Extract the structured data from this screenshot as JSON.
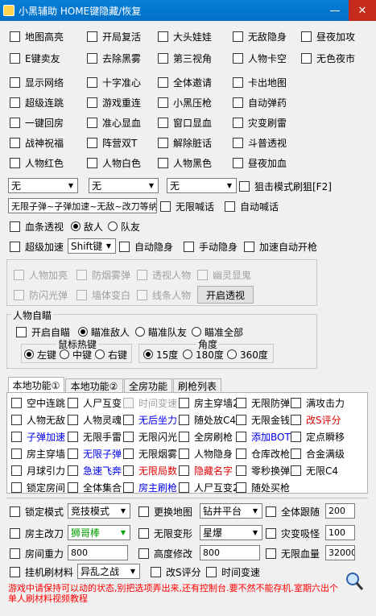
{
  "window": {
    "title": "小黑辅助  HOME键隐藏/恢复",
    "minimize": "—",
    "close": "✕"
  },
  "top_checks": [
    [
      "地图高亮",
      "开局复活",
      "大头娃娃",
      "无敌隐身",
      "昼夜加攻"
    ],
    [
      "E键卖友",
      "去除黑雾",
      "第三视角",
      "人物卡空",
      "无色夜市"
    ],
    [
      "显示网络",
      "十字准心",
      "全体邀请",
      "卡出地图"
    ],
    [
      "超级连跳",
      "游戏重连",
      "小黑压枪",
      "自动弹药"
    ],
    [
      "一键回房",
      "准心显血",
      "窗口显血",
      "灾变刷雷"
    ],
    [
      "战神祝福",
      "阵营双T",
      "解除脏话",
      "斗普透视"
    ],
    [
      "人物红色",
      "人物白色",
      "人物黑色",
      "昼夜加血"
    ]
  ],
  "combo1": {
    "a": "无",
    "b": "无",
    "c": "无"
  },
  "sniper_label": "狙击模式刷狙[F2]",
  "spam_text": "无限子弹~子弹加速~无敌~改刀等纳",
  "unlimited_shout": "无限喊话",
  "auto_shout": "自动喊话",
  "blood_perspective": "血条透视",
  "enemy": "敌人",
  "teammate": "队友",
  "super_speed": "超级加速",
  "shift_key": "Shift键",
  "auto_stealth": "自动隐身",
  "manual_stealth": "手动隐身",
  "speed_auto_fire": "加速自动开枪",
  "disabled_group": {
    "items": [
      "人物加亮",
      "防烟雾弹",
      "透视人物",
      "幽灵显鬼",
      "防闪光弹",
      "墙体变白",
      "线条人物"
    ],
    "button": "开启透视"
  },
  "aimbot": {
    "group_label": "人物自瞄",
    "enable": "开启自瞄",
    "aim_enemy": "瞄准敌人",
    "aim_team": "瞄准队友",
    "aim_all": "瞄准全部",
    "hotkey_label": "鼠标热键",
    "left": "左键",
    "middle": "中键",
    "right": "右键",
    "angle_label": "角度",
    "a15": "15度",
    "a180": "180度",
    "a360": "360度"
  },
  "tabs": [
    "本地功能①",
    "本地功能②",
    "全房功能",
    "刷枪列表"
  ],
  "tab_items": [
    {
      "t": "空中连跳",
      "c": ""
    },
    {
      "t": "人尸互变",
      "c": ""
    },
    {
      "t": "时间变速",
      "c": "dis"
    },
    {
      "t": "房主穿墙2",
      "c": ""
    },
    {
      "t": "无限防弹",
      "c": ""
    },
    {
      "t": "满攻击力",
      "c": ""
    },
    {
      "t": "人物无敌",
      "c": ""
    },
    {
      "t": "人物灵魂",
      "c": ""
    },
    {
      "t": "无后坐力",
      "c": "blue"
    },
    {
      "t": "随处放C4",
      "c": ""
    },
    {
      "t": "无限金钱",
      "c": ""
    },
    {
      "t": "改S评分",
      "c": "red"
    },
    {
      "t": "子弹加速",
      "c": "blue"
    },
    {
      "t": "无限手雷",
      "c": ""
    },
    {
      "t": "无限闪光",
      "c": ""
    },
    {
      "t": "全房刷枪",
      "c": ""
    },
    {
      "t": "添加BOT",
      "c": "blue"
    },
    {
      "t": "定点瞬移",
      "c": ""
    },
    {
      "t": "房主穿墙",
      "c": ""
    },
    {
      "t": "无限子弹",
      "c": "blue"
    },
    {
      "t": "无限烟雾",
      "c": ""
    },
    {
      "t": "人物隐身",
      "c": ""
    },
    {
      "t": "仓库改枪",
      "c": ""
    },
    {
      "t": "合金满级",
      "c": ""
    },
    {
      "t": "月球引力",
      "c": ""
    },
    {
      "t": "急速飞奔",
      "c": "blue"
    },
    {
      "t": "无限局数",
      "c": "red"
    },
    {
      "t": "隐藏名字",
      "c": "red"
    },
    {
      "t": "零秒换弹",
      "c": ""
    },
    {
      "t": "无限C4",
      "c": ""
    },
    {
      "t": "锁定房间",
      "c": ""
    },
    {
      "t": "全体集合",
      "c": ""
    },
    {
      "t": "房主刷枪",
      "c": "blue"
    },
    {
      "t": "人尸互变2",
      "c": ""
    },
    {
      "t": "随处买枪",
      "c": ""
    }
  ],
  "bottom": {
    "lock_mode": "锁定模式",
    "lock_mode_val": "竞技模式",
    "change_map": "更换地图",
    "change_map_val": "钻井平台",
    "full_follow": "全体跟随",
    "full_follow_val": "200",
    "host_change": "房主改刀",
    "host_change_val": "狮哥棒",
    "infinite_transform": "无限变形",
    "infinite_transform_val": "星爆",
    "disaster_absorb": "灾变吸怪",
    "disaster_absorb_val": "100",
    "room_gravity": "房间重力",
    "room_gravity_val": "800",
    "height_mod": "高度修改",
    "height_mod_val": "800",
    "infinite_hp": "无限血量",
    "infinite_hp_val": "32000",
    "hang_material": "挂机刷材料",
    "hang_material_val": "异乱之战",
    "change_s": "改S评分",
    "time_speed": "时间变速"
  },
  "warning": "游戏中请保持可以动的状态,别把选项弄出来,还有控制台.要不然不能存机.室期六出个单人刷材料视频教程"
}
